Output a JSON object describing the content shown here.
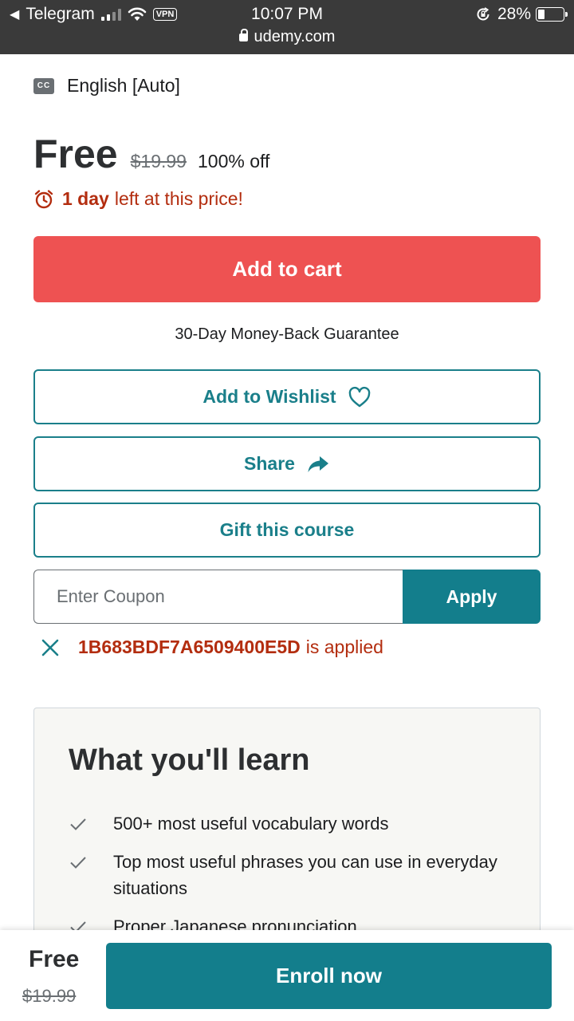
{
  "status_bar": {
    "back_app": "Telegram",
    "vpn": "VPN",
    "time": "10:07 PM",
    "url": "udemy.com",
    "battery": "28%",
    "battery_level": 0.28
  },
  "captions": {
    "label": "English [Auto]",
    "icon_text": "CC"
  },
  "pricing": {
    "current": "Free",
    "original": "$19.99",
    "discount": "100% off"
  },
  "timer": {
    "bold": "1 day",
    "rest": "left at this price!"
  },
  "buttons": {
    "add_to_cart": "Add to cart",
    "wishlist": "Add to Wishlist",
    "share": "Share",
    "gift": "Gift this course",
    "apply": "Apply",
    "enroll": "Enroll now"
  },
  "guarantee": "30-Day Money-Back Guarantee",
  "coupon": {
    "placeholder": "Enter Coupon",
    "code": "1B683BDF7A6509400E5D",
    "applied_text": "is applied"
  },
  "learn": {
    "title": "What you'll learn",
    "items": [
      "500+ most useful vocabulary words",
      "Top most useful phrases you can use in everyday situations",
      "Proper Japanese pronunciation"
    ]
  },
  "bottom_bar": {
    "price": "Free",
    "original": "$19.99"
  },
  "colors": {
    "cart_red": "#ee5252",
    "teal": "#137e8c",
    "alert_red": "#b32d0f",
    "status_bar": "#3a3a3a"
  }
}
